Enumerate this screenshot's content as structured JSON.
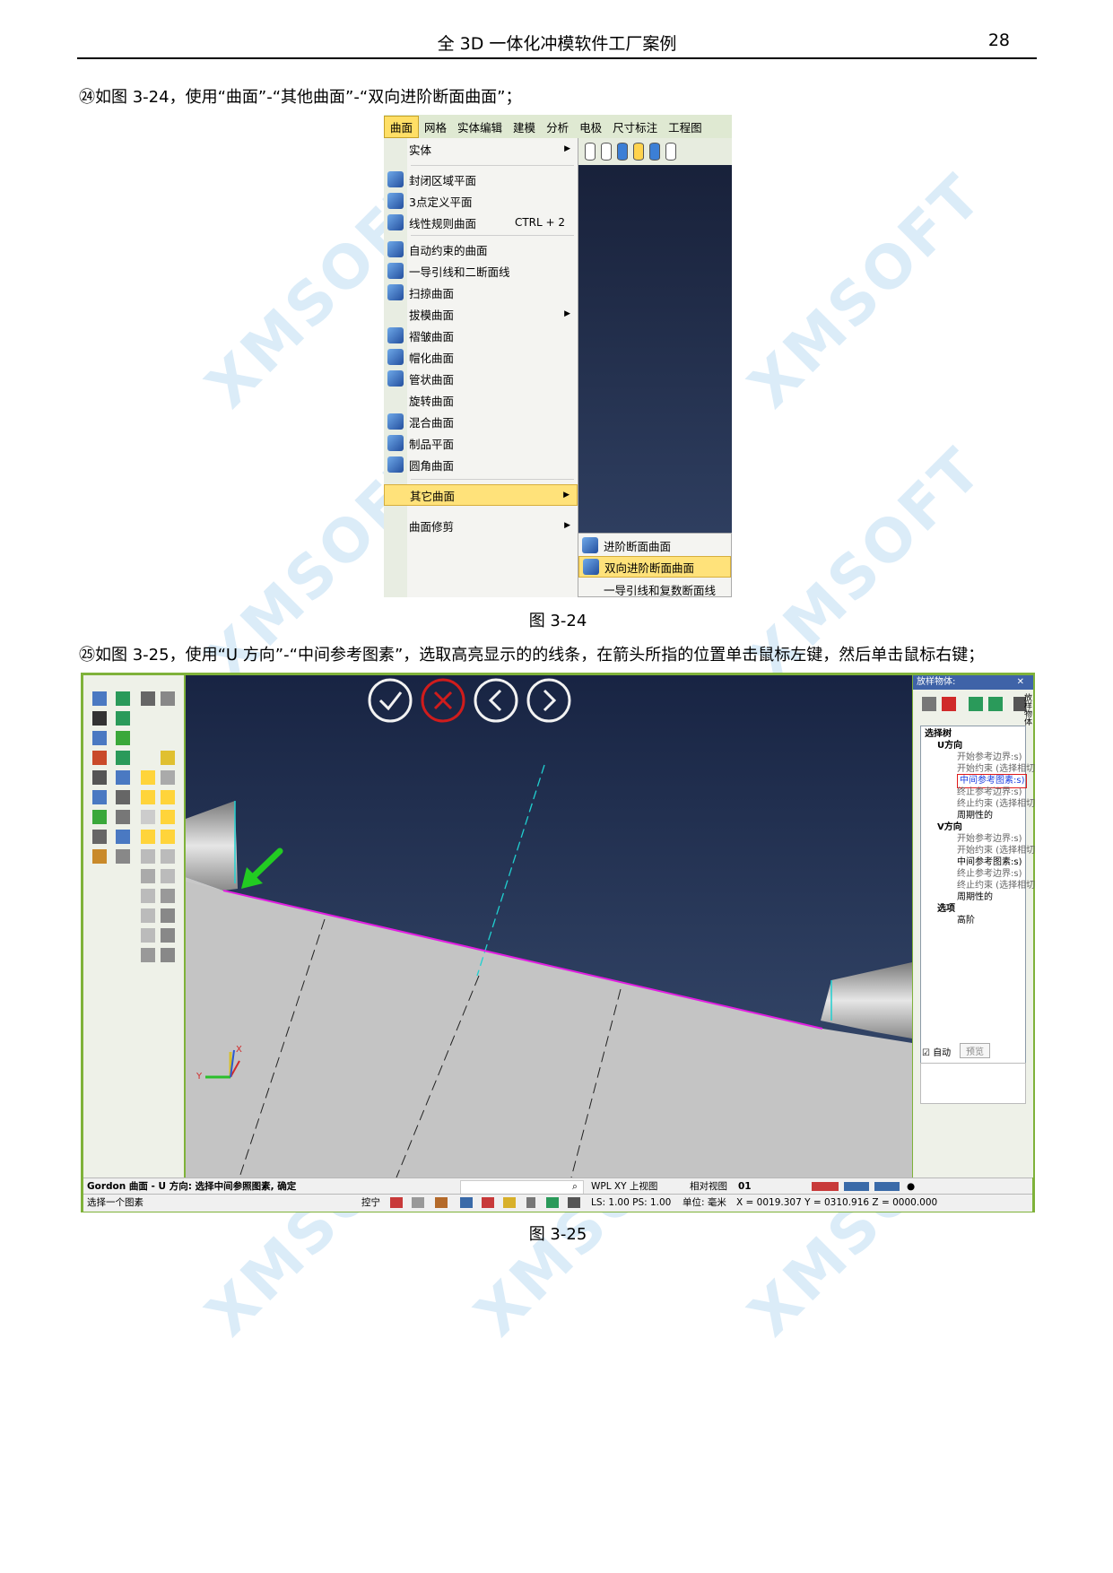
{
  "header": {
    "title": "全 3D 一体化冲模软件工厂案例",
    "page_number": "28"
  },
  "step24": {
    "text": "㉔如图 3-24，使用“曲面”-“其他曲面”-“双向进阶断面曲面”；"
  },
  "figure24": {
    "caption": "图 3-24",
    "menubar": [
      "曲面",
      "网格",
      "实体编辑",
      "建模",
      "分析",
      "电极",
      "尺寸标注",
      "工程图"
    ],
    "menu_items": [
      "实体",
      "封闭区域平面",
      "3点定义平面",
      "线性规则曲面",
      "自动约束的曲面",
      "一导引线和二断面线",
      "扫掠曲面",
      "拔模曲面",
      "褶皱曲面",
      "帽化曲面",
      "管状曲面",
      "旋转曲面",
      "混合曲面",
      "制品平面",
      "圆角曲面",
      "其它曲面",
      "曲面修剪"
    ],
    "shortcut": "CTRL + 2",
    "submenu_items": [
      "进阶断面曲面",
      "双向进阶断面曲面",
      "一导引线和复数断面线"
    ]
  },
  "step25": {
    "text": "㉕如图 3-25，使用“U 方向”-“中间参考图素”，选取高亮显示的的线条，在箭头所指的位置单击鼠标左键，然后单击鼠标右键；"
  },
  "figure25": {
    "caption": "图 3-25",
    "panel_title": "放样物体:",
    "panel_side_label": "放样物体",
    "tree": {
      "root": "选择树",
      "u_dir": "U方向",
      "u_items": [
        "开始参考边界:s)",
        "开始约束 (选择相切",
        "中间参考图素:s)",
        "终止参考边界:s)",
        "终止约束 (选择相切",
        "周期性的"
      ],
      "v_dir": "V方向",
      "v_items": [
        "开始参考边界:s)",
        "开始约束 (选择相切",
        "中间参考图素:s)",
        "终止参考边界:s)",
        "终止约束 (选择相切",
        "周期性的"
      ],
      "options": "选项",
      "option_items": [
        "高阶"
      ]
    },
    "auto_label": "自动",
    "preview_label": "预览",
    "axis_x": "X",
    "axis_y": "Y",
    "status_prompt": "Gordon 曲面 - U 方向: 选择中间参照图素, 确定",
    "status_wpl": "WPL XY 上视图",
    "status_view": "相对视图",
    "status_view_num": "01",
    "status_select": "选择一个图素",
    "status_lock": "控宁",
    "status_ls": "LS: 1.00 PS: 1.00",
    "status_unit": "单位: 毫米",
    "status_coords": "X = 0019.307 Y = 0310.916 Z = 0000.000"
  },
  "watermark": "XMSOFT",
  "colors": {
    "highlight_line": "#e11de1",
    "arrow": "#22cc22",
    "viewport_top": "#182443",
    "viewport_bottom": "#3b4f72"
  }
}
